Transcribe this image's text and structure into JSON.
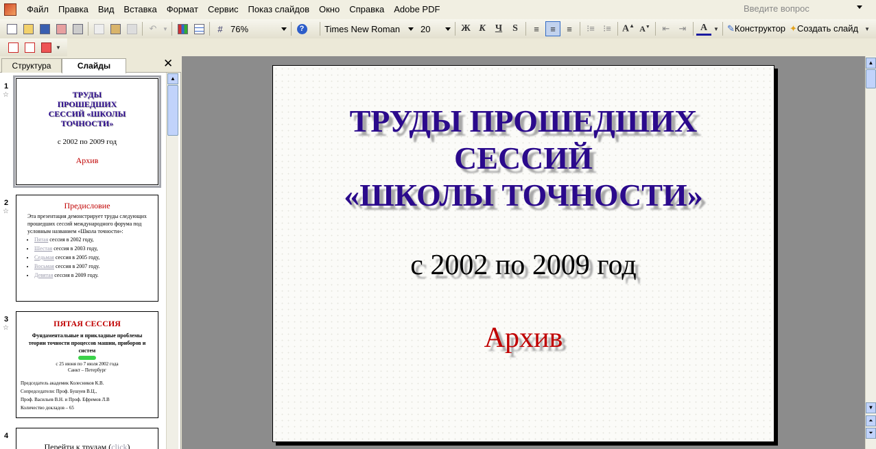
{
  "menu": [
    "Файл",
    "Правка",
    "Вид",
    "Вставка",
    "Формат",
    "Сервис",
    "Показ слайдов",
    "Окно",
    "Справка",
    "Adobe PDF"
  ],
  "question_placeholder": "Введите вопрос",
  "toolbar": {
    "zoom": "76%",
    "font_name": "Times New Roman",
    "font_size": "20",
    "bold": "Ж",
    "italic": "К",
    "underline": "Ч",
    "shadow": "S",
    "designer": "Конструктор",
    "new_slide": "Создать слайд"
  },
  "tabs": {
    "outline": "Структура",
    "slides": "Слайды",
    "close": "✕"
  },
  "thumbnails": [
    {
      "num": "1",
      "title": "ТРУДЫ ПРОШЕДШИХ СЕССИЙ «ШКОЛЫ ТОЧНОСТИ»",
      "sub": "с 2002 по 2009 год",
      "red": "Архив"
    },
    {
      "num": "2",
      "head": "Предисловие",
      "body": "Эта презентация демонстрирует труды следующих прошедших сессий международного форума под условным названием «Школа точности»:",
      "items": [
        {
          "link": "Пятая",
          "text": " сессия в 2002 году,"
        },
        {
          "link": "Шестая",
          "text": " сессия в 2003 году,"
        },
        {
          "link": "Седьмая",
          "text": " сессия в 2005 году,"
        },
        {
          "link": "Восьмая",
          "text": " сессия в 2007 году."
        },
        {
          "link": "Девятая",
          "text": " сессия в 2009 году."
        }
      ]
    },
    {
      "num": "3",
      "head": "ПЯТАЯ СЕССИЯ",
      "bold": "Фундаментальные и прикладные проблемы теории точности процессов машин, приборов и систем",
      "dates": "с 25 июня по 7 июля 2002 года",
      "city": "Санкт – Петербург",
      "lines": [
        "Председатель академик Колесников К.В.",
        "Сопредседатели: Проф. Бушуев В.Ц.,",
        "Проф. Васильев В.Н. и Проф. Ефремов Л.В",
        "Количество докладов – 65"
      ]
    },
    {
      "num": "4",
      "text": "Перейти к трудам (",
      "link": "click",
      "text_end": ")"
    }
  ],
  "slide": {
    "title_lines": [
      "ТРУДЫ  ПРОШЕДШИХ",
      "СЕССИЙ",
      "«ШКОЛЫ ТОЧНОСТИ»"
    ],
    "subtitle": "с 2002 по 2009 год",
    "red_text": "Архив"
  }
}
